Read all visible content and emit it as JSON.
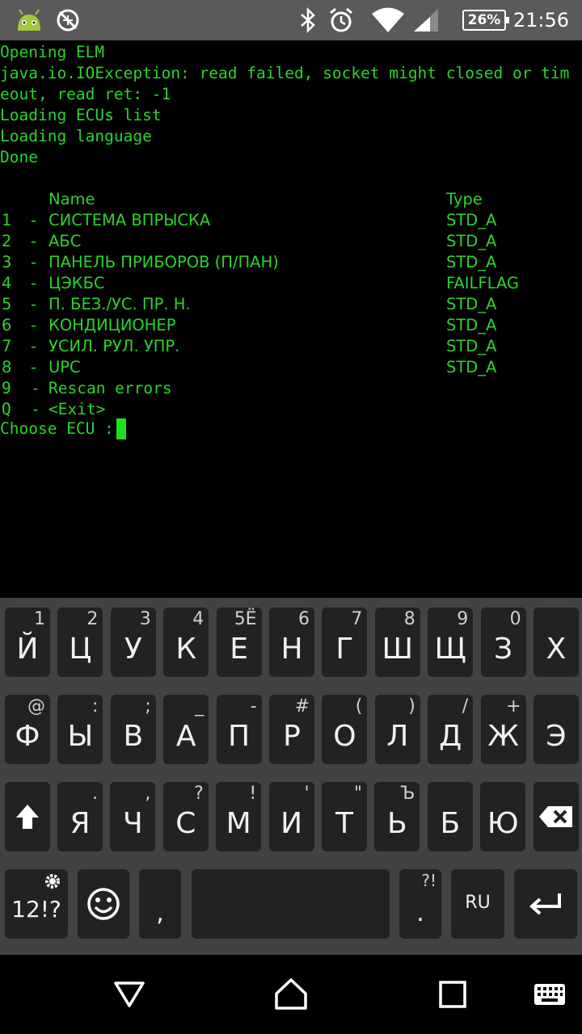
{
  "status_bar": {
    "time": "21:56",
    "battery": "26%",
    "icons": [
      "android-debug-icon",
      "no-network-icon",
      "bluetooth-icon",
      "alarm-icon",
      "wifi-icon",
      "cell-signal-icon"
    ]
  },
  "terminal": {
    "lines": [
      "Opening ELM",
      "java.io.IOException: read failed, socket might closed or tim",
      "eout, read ret: -1",
      "Loading ECUs list",
      "Loading language",
      "Done"
    ],
    "header_name": "Name",
    "header_type": "Type",
    "ecus": [
      {
        "num": "1",
        "name": "СИСТЕМА ВПРЫСКА",
        "type": "STD_A"
      },
      {
        "num": "2",
        "name": "АБС",
        "type": "STD_A"
      },
      {
        "num": "3",
        "name": "ПАНЕЛЬ ПРИБОРОВ (П/ПАН)",
        "type": "STD_A"
      },
      {
        "num": "4",
        "name": "ЦЭКБС",
        "type": "FAILFLAG"
      },
      {
        "num": "5",
        "name": "П. БЕЗ./УС. ПР. Н.",
        "type": "STD_A"
      },
      {
        "num": "6",
        "name": "КОНДИЦИОНЕР",
        "type": "STD_A"
      },
      {
        "num": "7",
        "name": "УСИЛ. РУЛ. УПР.",
        "type": "STD_A"
      },
      {
        "num": "8",
        "name": "UPC",
        "type": "STD_A"
      }
    ],
    "extra_options": [
      {
        "num": "9",
        "label": "Rescan errors"
      },
      {
        "num": "Q",
        "label": "<Exit>"
      }
    ],
    "separator": "-",
    "prompt": "Choose ECU :"
  },
  "keyboard": {
    "row1": [
      {
        "main": "Й",
        "hint": "1"
      },
      {
        "main": "Ц",
        "hint": "2"
      },
      {
        "main": "У",
        "hint": "3"
      },
      {
        "main": "К",
        "hint": "4"
      },
      {
        "main": "Е",
        "hint": "5Ё"
      },
      {
        "main": "Н",
        "hint": "6"
      },
      {
        "main": "Г",
        "hint": "7"
      },
      {
        "main": "Ш",
        "hint": "8"
      },
      {
        "main": "Щ",
        "hint": "9"
      },
      {
        "main": "З",
        "hint": "0"
      },
      {
        "main": "Х",
        "hint": ""
      }
    ],
    "row2": [
      {
        "main": "Ф",
        "hint": "@"
      },
      {
        "main": "Ы",
        "hint": ":"
      },
      {
        "main": "В",
        "hint": ";"
      },
      {
        "main": "А",
        "hint": "_"
      },
      {
        "main": "П",
        "hint": "-"
      },
      {
        "main": "Р",
        "hint": "#"
      },
      {
        "main": "О",
        "hint": "("
      },
      {
        "main": "Л",
        "hint": ")"
      },
      {
        "main": "Д",
        "hint": "/"
      },
      {
        "main": "Ж",
        "hint": "+"
      },
      {
        "main": "Э",
        "hint": ""
      }
    ],
    "row3": [
      {
        "main": "Я",
        "hint": "."
      },
      {
        "main": "Ч",
        "hint": ","
      },
      {
        "main": "С",
        "hint": "?"
      },
      {
        "main": "М",
        "hint": "!"
      },
      {
        "main": "И",
        "hint": "'"
      },
      {
        "main": "Т",
        "hint": "\""
      },
      {
        "main": "Ь",
        "hint": "Ъ"
      },
      {
        "main": "Б",
        "hint": ""
      },
      {
        "main": "Ю",
        "hint": ""
      }
    ],
    "symbols_label": "12!?",
    "comma_label": ",",
    "period_label": ".",
    "period_hint": "?!",
    "language_label": "RU"
  }
}
